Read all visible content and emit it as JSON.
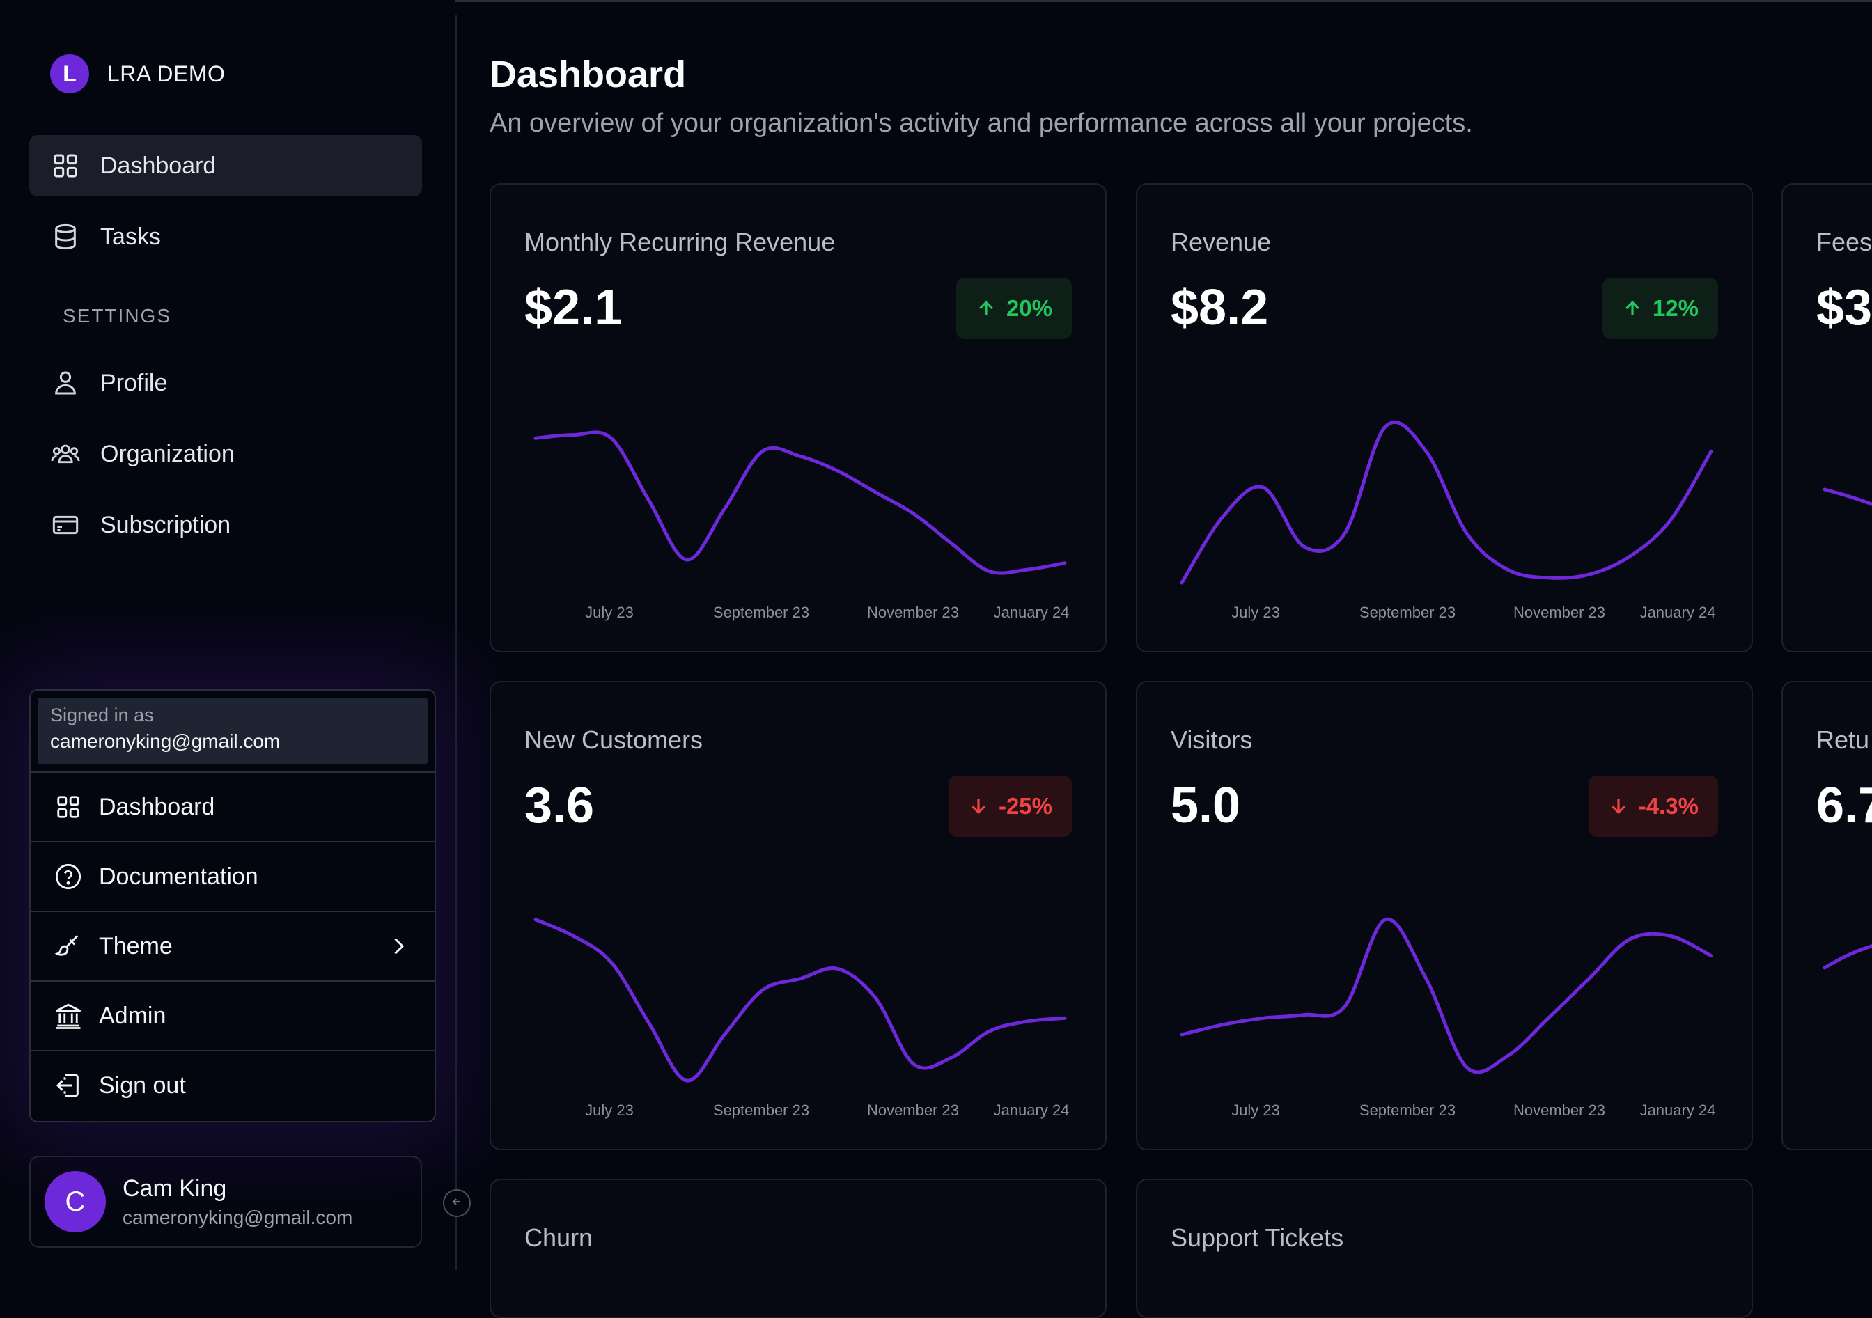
{
  "app": {
    "name": "LRA DEMO",
    "logo_letter": "L"
  },
  "sidebar": {
    "items": [
      {
        "label": "Dashboard",
        "icon": "grid-icon",
        "active": true
      },
      {
        "label": "Tasks",
        "icon": "database-icon"
      }
    ],
    "settings_label": "SETTINGS",
    "settings_items": [
      {
        "label": "Profile",
        "icon": "user-icon"
      },
      {
        "label": "Organization",
        "icon": "users-icon"
      },
      {
        "label": "Subscription",
        "icon": "credit-card-icon"
      }
    ]
  },
  "user_menu": {
    "signed_in_label": "Signed in as",
    "email": "cameronyking@gmail.com",
    "items": [
      {
        "label": "Dashboard",
        "icon": "grid-icon"
      },
      {
        "label": "Documentation",
        "icon": "help-circle-icon"
      },
      {
        "label": "Theme",
        "icon": "brush-icon",
        "has_submenu": true
      },
      {
        "label": "Admin",
        "icon": "bank-icon"
      },
      {
        "label": "Sign out",
        "icon": "sign-out-icon"
      }
    ]
  },
  "user": {
    "initial": "C",
    "name": "Cam King",
    "email": "cameronyking@gmail.com"
  },
  "page": {
    "title": "Dashboard",
    "subtitle": "An overview of your organization's activity and performance across all your projects."
  },
  "colors": {
    "accent": "#6d28d9",
    "line": "#6d28d9",
    "positive": "#22c55e",
    "negative": "#ef4444"
  },
  "cards": [
    {
      "title": "Monthly Recurring Revenue",
      "value": "$2.1",
      "change": "20%",
      "direction": "up"
    },
    {
      "title": "Revenue",
      "value": "$8.2",
      "change": "12%",
      "direction": "up"
    },
    {
      "title": "Fees",
      "value": "$3",
      "change": "",
      "direction": ""
    },
    {
      "title": "New Customers",
      "value": "3.6",
      "change": "-25%",
      "direction": "down"
    },
    {
      "title": "Visitors",
      "value": "5.0",
      "change": "-4.3%",
      "direction": "down"
    },
    {
      "title": "Retu",
      "value": "6.7",
      "change": "",
      "direction": ""
    },
    {
      "title": "Churn",
      "value": "",
      "change": "",
      "direction": ""
    },
    {
      "title": "Support Tickets",
      "value": "",
      "change": "",
      "direction": ""
    }
  ],
  "chart_data": [
    {
      "type": "line",
      "title": "Monthly Recurring Revenue",
      "x_ticks": [
        "July 23",
        "September 23",
        "November 23",
        "January 24"
      ],
      "values": [
        0.88,
        0.9,
        0.88,
        0.5,
        0.14,
        0.45,
        0.8,
        0.77,
        0.68,
        0.55,
        0.42,
        0.24,
        0.07,
        0.08,
        0.12
      ],
      "grid": false
    },
    {
      "type": "line",
      "title": "Revenue",
      "x_ticks": [
        "July 23",
        "September 23",
        "November 23",
        "January 24"
      ],
      "values": [
        0.0,
        0.4,
        0.58,
        0.22,
        0.3,
        0.95,
        0.8,
        0.3,
        0.08,
        0.03,
        0.05,
        0.16,
        0.38,
        0.8
      ],
      "grid": false
    },
    {
      "type": "line",
      "title": "New Customers",
      "x_ticks": [
        "July 23",
        "September 23",
        "November 23",
        "January 24"
      ],
      "values": [
        0.98,
        0.88,
        0.72,
        0.35,
        0.0,
        0.28,
        0.55,
        0.62,
        0.68,
        0.5,
        0.1,
        0.14,
        0.3,
        0.36,
        0.38
      ],
      "grid": false
    },
    {
      "type": "line",
      "title": "Visitors",
      "x_ticks": [
        "July 23",
        "September 23",
        "November 23",
        "January 24"
      ],
      "values": [
        0.28,
        0.34,
        0.38,
        0.4,
        0.45,
        0.98,
        0.62,
        0.08,
        0.15,
        0.38,
        0.62,
        0.86,
        0.88,
        0.76
      ],
      "grid": false
    }
  ]
}
